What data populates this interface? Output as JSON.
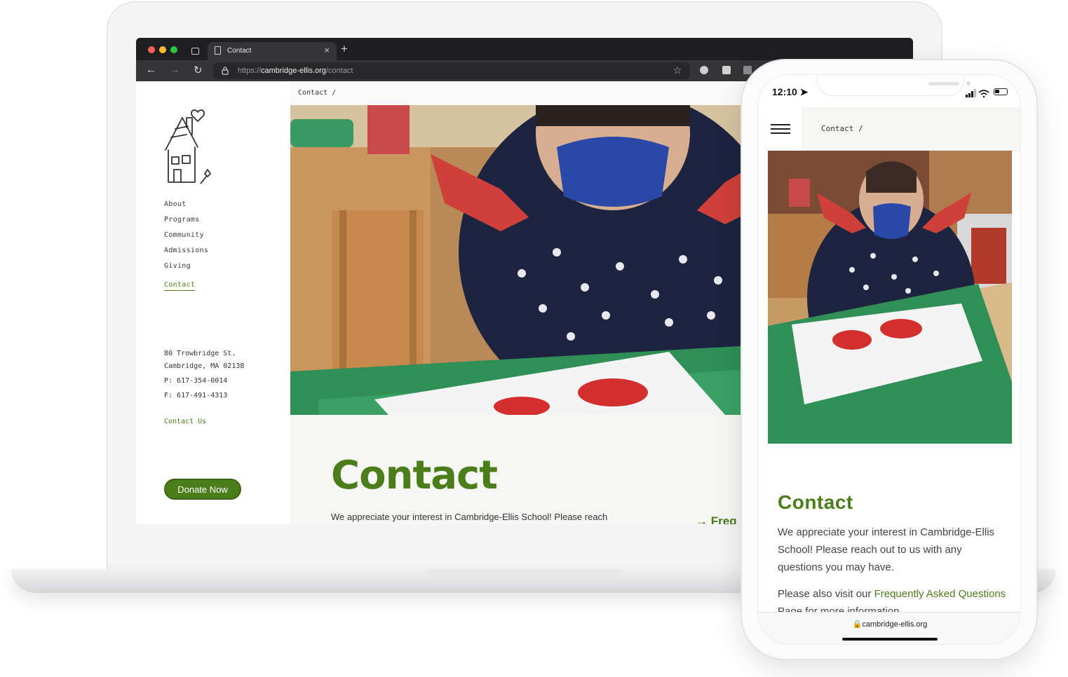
{
  "browser": {
    "tab_title": "Contact",
    "new_tab_symbol": "+",
    "url_prefix": "https://",
    "url_host": "cambridge-ellis.org",
    "url_path": "/contact",
    "icons": [
      "sidebar-icon",
      "document-icon",
      "close-icon",
      "back-icon",
      "forward-icon",
      "reload-icon",
      "lock-icon",
      "bookmark-icon",
      "extension-icon"
    ]
  },
  "site": {
    "breadcrumb": "Contact  /",
    "nav": [
      "About",
      "Programs",
      "Community",
      "Admissions",
      "Giving",
      "Contact"
    ],
    "active_nav": "Contact",
    "address": {
      "street": "80 Trowbridge St.",
      "city": "Cambridge, MA 02138",
      "phone": "P: 617-354-0014",
      "fax": "F: 617-491-4313"
    },
    "contact_link": "Contact Us",
    "donate_label": "Donate Now",
    "page_title": "Contact",
    "intro": "We appreciate your interest in Cambridge-Ellis School! Please reach",
    "faq_link_partial": "Freq",
    "brand_color": "#4c7d1b"
  },
  "phone": {
    "time": "12:10",
    "breadcrumb": "Contact  /",
    "title": "Contact",
    "paragraph1": "We appreciate your interest in Cambridge-Ellis School! Please reach out to us with any questions you may have.",
    "paragraph2_start": "Please also visit our ",
    "paragraph2_link": "Frequently Asked Questions",
    "paragraph2_end": " Page for more information.",
    "safari_url": "cambridge-ellis.org"
  }
}
